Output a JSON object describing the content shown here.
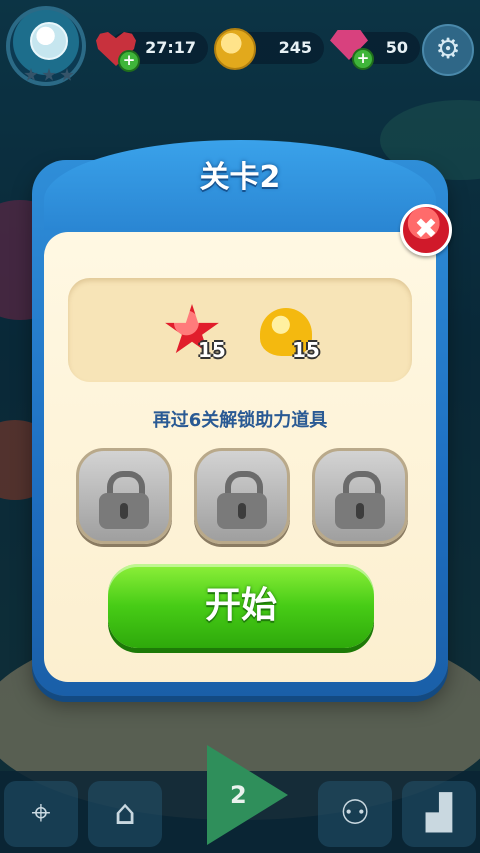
{
  "topbar": {
    "lives_timer": "27:17",
    "coins": "245",
    "gems": "50",
    "plus_symbol": "+",
    "settings_glyph": "⚙"
  },
  "dialog": {
    "title": "关卡2",
    "close_symbol": "✖",
    "goals": [
      {
        "icon": "red-star-icon",
        "count": "15"
      },
      {
        "icon": "yellow-shell-icon",
        "count": "15"
      }
    ],
    "unlock_text": "再过6关解锁助力道具",
    "locked_slots": 3,
    "start_label": "开始"
  },
  "bottombar": {
    "current_level": "2",
    "items": [
      "map-icon",
      "shop-icon",
      "play-icon",
      "team-icon",
      "leaderboard-icon"
    ]
  },
  "colors": {
    "dialog_blue": "#1e6fc2",
    "start_green": "#47cc16",
    "close_red": "#d0192a",
    "unlock_text": "#2a5a94"
  }
}
